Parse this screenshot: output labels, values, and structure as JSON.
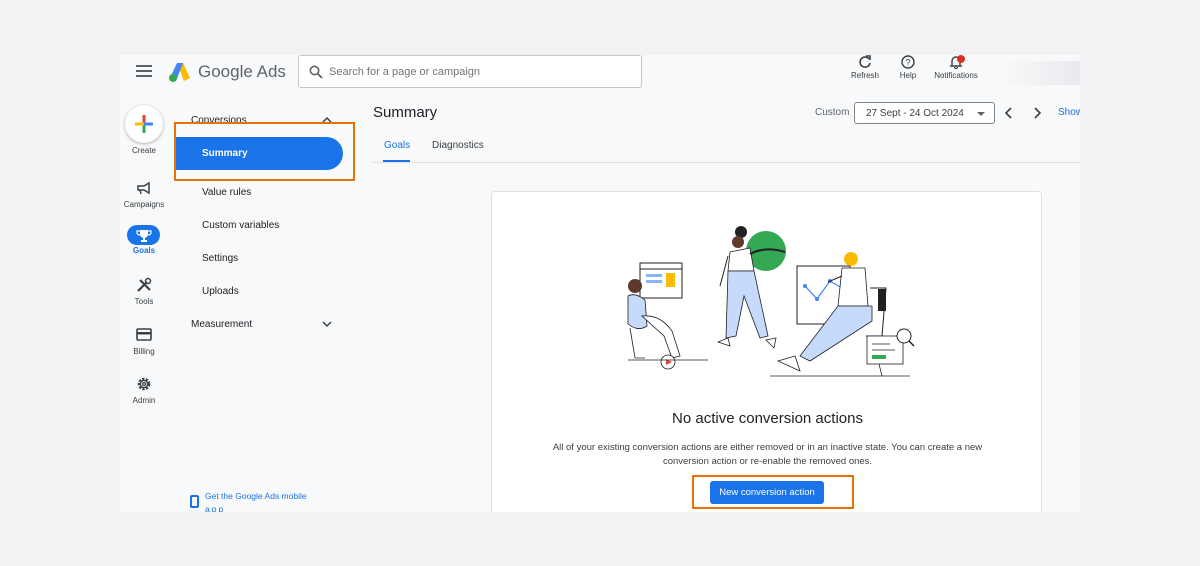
{
  "header": {
    "brand": "Google Ads",
    "search_placeholder": "Search for a page or campaign",
    "actions": [
      {
        "label": "Refresh",
        "icon": "refresh-icon"
      },
      {
        "label": "Help",
        "icon": "help-icon"
      },
      {
        "label": "Notifications",
        "icon": "bell-icon"
      }
    ]
  },
  "rail": {
    "create_label": "Create",
    "items": [
      {
        "label": "Campaigns",
        "icon": "megaphone-icon"
      },
      {
        "label": "Goals",
        "icon": "trophy-icon",
        "active": true
      },
      {
        "label": "Tools",
        "icon": "tools-icon"
      },
      {
        "label": "Billing",
        "icon": "credit-card-icon"
      },
      {
        "label": "Admin",
        "icon": "gear-icon"
      }
    ]
  },
  "subnav": {
    "section": "Conversions",
    "items": [
      "Summary",
      "Value rules",
      "Custom variables",
      "Settings",
      "Uploads"
    ],
    "active": "Summary",
    "section2": "Measurement",
    "mobile_link": "Get the Google Ads mobile",
    "mobile_link_cont": "app"
  },
  "main": {
    "title": "Summary",
    "date_label": "Custom",
    "date_range": "27 Sept - 24 Oct 2024",
    "show_link": "Show",
    "tabs": [
      "Goals",
      "Diagnostics"
    ],
    "empty_title": "No active conversion actions",
    "empty_desc": "All of your existing conversion actions are either removed or in an inactive state. You can create a new conversion action or re-enable the removed ones.",
    "cta": "New conversion action"
  },
  "colors": {
    "accent": "#1a73e8",
    "highlight": "#e8710a"
  }
}
